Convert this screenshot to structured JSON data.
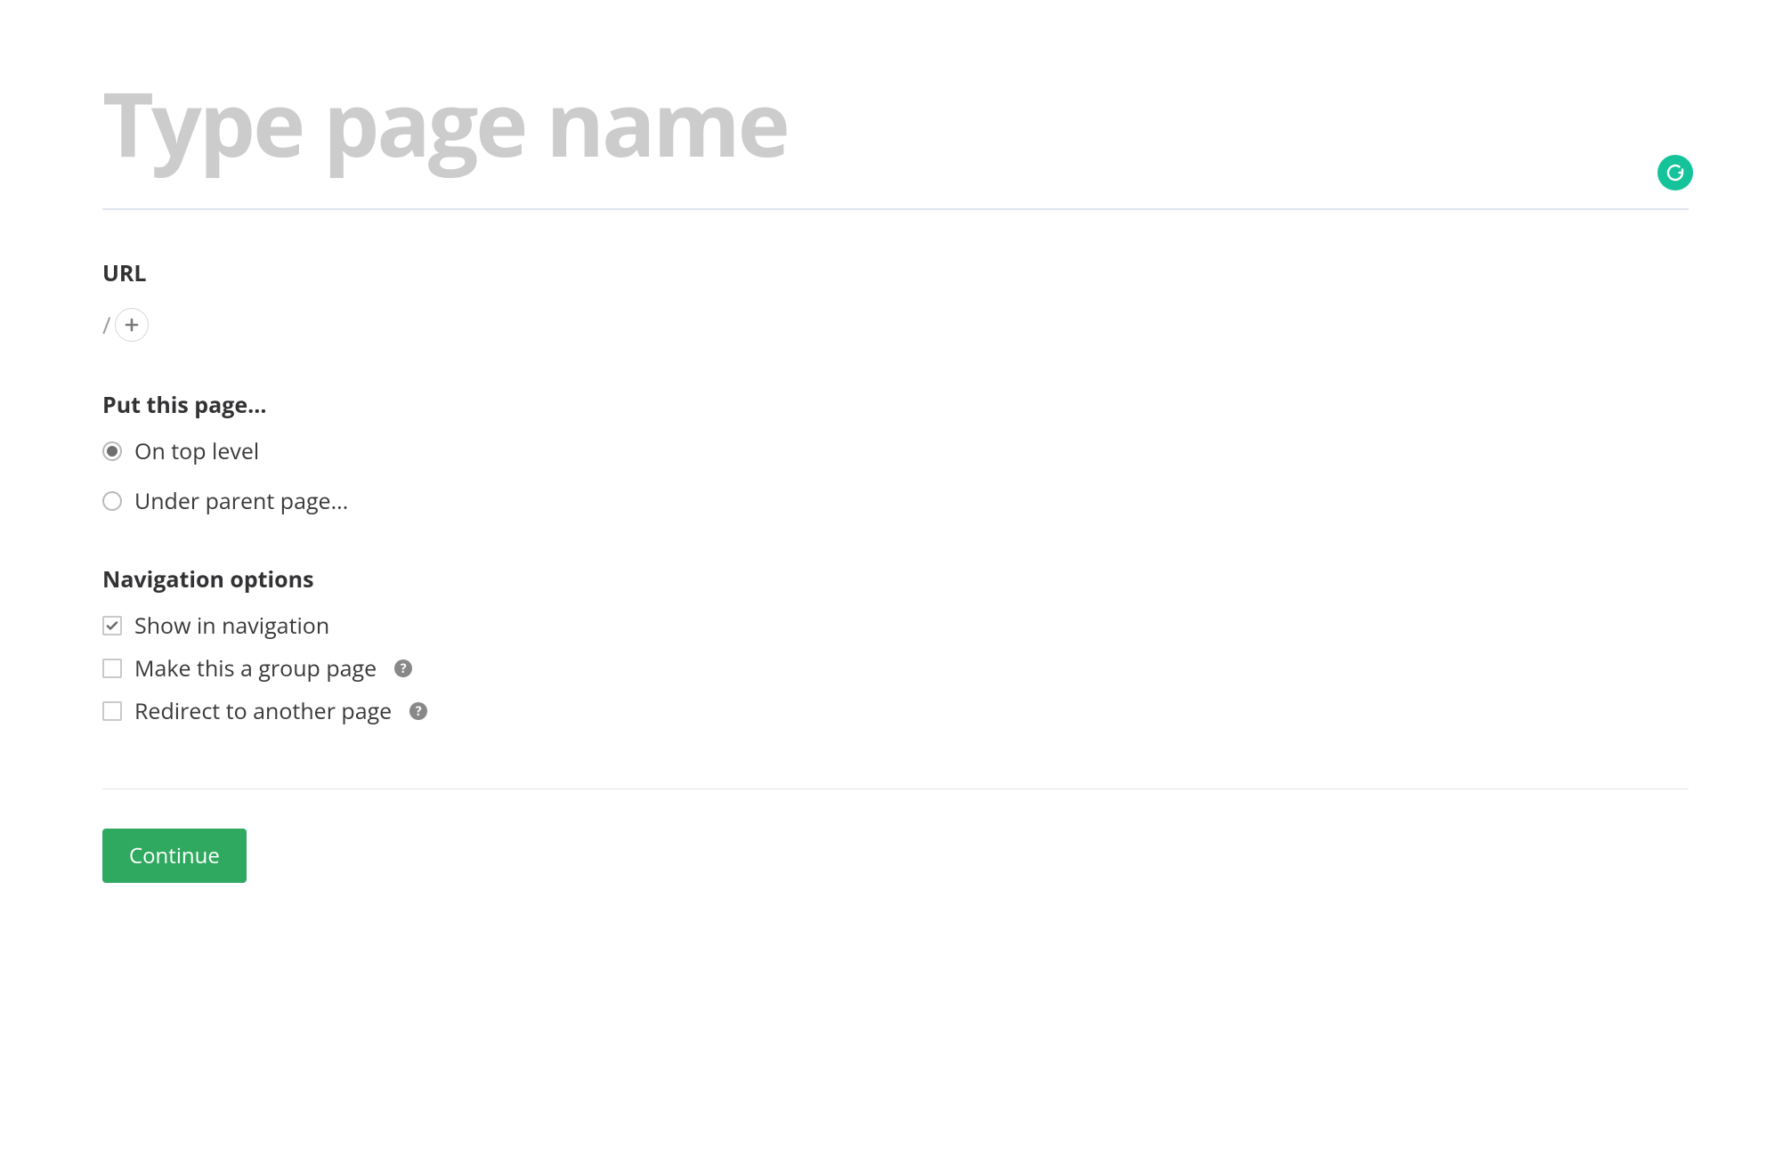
{
  "title": {
    "placeholder": "Type page name",
    "value": ""
  },
  "url": {
    "label": "URL",
    "prefix": "/"
  },
  "placement": {
    "label": "Put this page...",
    "options": [
      {
        "label": "On top level",
        "selected": true
      },
      {
        "label": "Under parent page...",
        "selected": false
      }
    ]
  },
  "navigation": {
    "label": "Navigation options",
    "options": [
      {
        "label": "Show in navigation",
        "checked": true,
        "help": false
      },
      {
        "label": "Make this a group page",
        "checked": false,
        "help": true
      },
      {
        "label": "Redirect to another page",
        "checked": false,
        "help": true
      }
    ]
  },
  "actions": {
    "continue": "Continue"
  },
  "help_glyph": "?"
}
